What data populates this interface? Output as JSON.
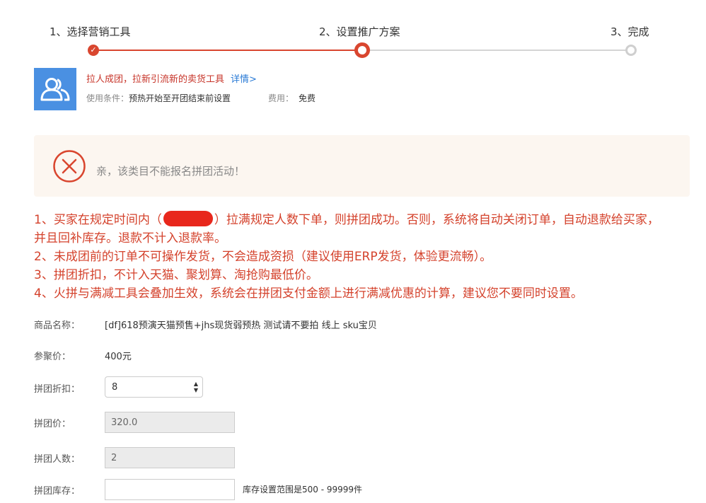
{
  "stepper": {
    "steps": [
      {
        "label": "1、选择营销工具"
      },
      {
        "label": "2、设置推广方案"
      },
      {
        "label": "3、完成"
      }
    ],
    "current_step": 2
  },
  "tool": {
    "icon": "users-icon",
    "description": "拉人成团，拉新引流新的卖货工具",
    "detail_link": "详情>",
    "condition_label": "使用条件：",
    "condition_value": "预热开始至开团结束前设置",
    "fee_label": "费用：",
    "fee_value": "免费"
  },
  "error": {
    "icon": "error-x-icon",
    "message": "亲，该类目不能报名拼团活动！"
  },
  "rules": {
    "rule1_before": "1、买家在规定时间内（",
    "rule1_after": "）拉满规定人数下单，则拼团成功。否则，系统将自动关闭订单，自动退款给买家，",
    "rule1_line2": "并且回补库存。退款不计入退款率。",
    "rule2": "2、未成团前的订单不可操作发货，不会造成资损（建议使用ERP发货，体验更流畅）。",
    "rule3": "3、拼团折扣，不计入天猫、聚划算、淘抢购最低价。",
    "rule4": "4、火拼与满减工具会叠加生效，系统会在拼团支付金额上进行满减优惠的计算，建议您不要同时设置。"
  },
  "form": {
    "product_name_label": "商品名称：",
    "product_name_value": "[df]618预演天猫预售+jhs现货弱预热 测试请不要拍 线上 sku宝贝",
    "ref_price_label": "参聚价：",
    "ref_price_value": "400元",
    "discount_label": "拼团折扣：",
    "discount_value": "8",
    "group_price_label": "拼团价：",
    "group_price_value": "320.0",
    "group_size_label": "拼团人数：",
    "group_size_value": "2",
    "stock_label": "拼团库存：",
    "stock_value": "",
    "stock_hint": "库存设置范围是500 - 99999件"
  },
  "colors": {
    "accent_red": "#d9462f",
    "rule_red": "#d4422c",
    "link_blue": "#2a7bd6",
    "icon_blue": "#4a90e2",
    "error_bg": "#fcf6f0"
  }
}
